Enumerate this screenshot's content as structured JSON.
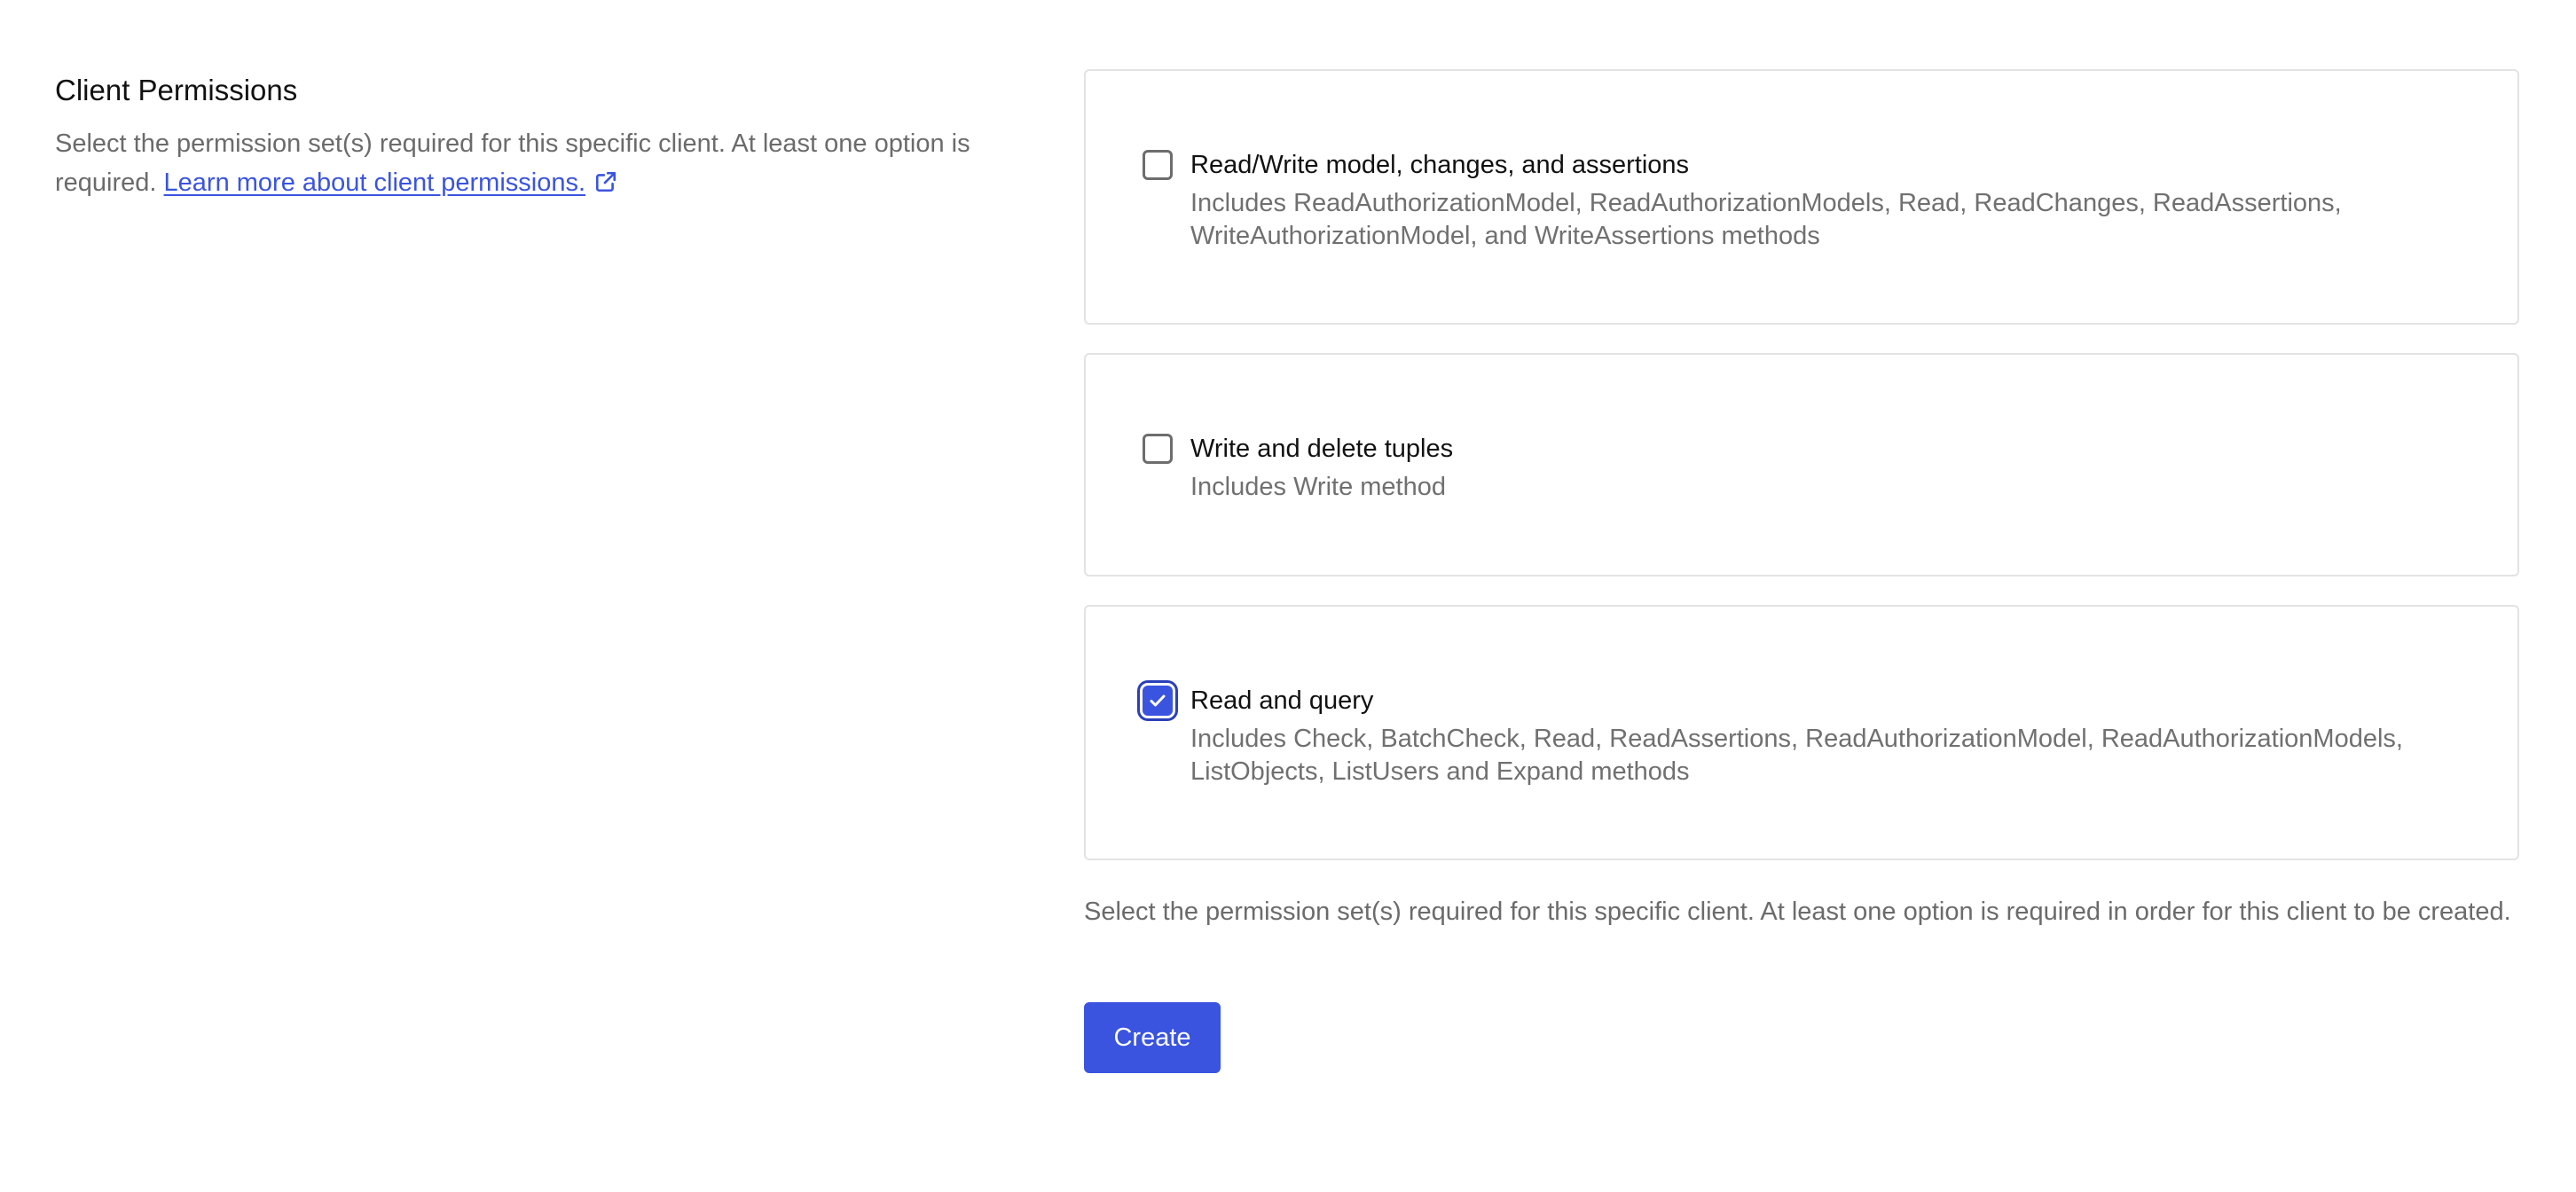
{
  "section": {
    "title": "Client Permissions",
    "description": "Select the permission set(s) required for this specific client. At least one option is required.",
    "link_text": "Learn more about client permissions."
  },
  "options": [
    {
      "title": "Read/Write model, changes, and assertions",
      "description": "Includes ReadAuthorizationModel, ReadAuthorizationModels, Read, ReadChanges, ReadAssertions, WriteAuthorizationModel, and WriteAssertions methods",
      "checked": false
    },
    {
      "title": "Write and delete tuples",
      "description": "Includes Write method",
      "checked": false
    },
    {
      "title": "Read and query",
      "description": "Includes Check, BatchCheck, Read, ReadAssertions, ReadAuthorizationModel, ReadAuthorizationModels, ListObjects, ListUsers and Expand methods",
      "checked": true
    }
  ],
  "helper_text": "Select the permission set(s) required for this specific client. At least one option is required in order for this client to be created.",
  "create_button": {
    "label": "Create"
  },
  "icons": {
    "external_link": "external-link-icon",
    "check": "check-icon"
  },
  "colors": {
    "accent": "#3a54e0",
    "text_primary": "#111111",
    "text_secondary": "#6b6b6b",
    "card_border": "#e3e3e3"
  }
}
